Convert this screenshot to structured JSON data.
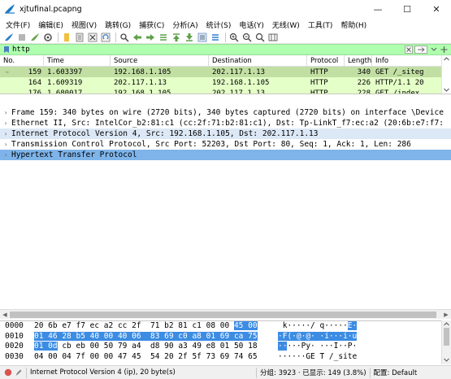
{
  "window": {
    "title": "xjtufinal.pcapng",
    "minimize_glyph": "—",
    "maximize_glyph": "☐",
    "close_glyph": "✕"
  },
  "menu": [
    "文件(F)",
    "编辑(E)",
    "视图(V)",
    "跳转(G)",
    "捕获(C)",
    "分析(A)",
    "统计(S)",
    "电话(Y)",
    "无线(W)",
    "工具(T)",
    "帮助(H)"
  ],
  "filter": {
    "value": "http",
    "accent": "#afffaf"
  },
  "packet_list": {
    "columns": [
      "No.",
      "Time",
      "Source",
      "Destination",
      "Protocol",
      "Length",
      "Info"
    ],
    "rows": [
      {
        "no": "159",
        "time": "1.603397",
        "src": "192.168.1.105",
        "dst": "202.117.1.13",
        "proto": "HTTP",
        "len": "340",
        "info": "GET /_siteg",
        "selected": true,
        "mark": "→"
      },
      {
        "no": "164",
        "time": "1.609319",
        "src": "202.117.1.13",
        "dst": "192.168.1.105",
        "proto": "HTTP",
        "len": "226",
        "info": "HTTP/1.1 20",
        "selected": false,
        "mark": ""
      },
      {
        "no": "176",
        "time": "1.680017",
        "src": "192.168.1.105",
        "dst": "202.117.1.13",
        "proto": "HTTP",
        "len": "228",
        "info": "GET /index",
        "selected": false,
        "mark": ""
      }
    ]
  },
  "details": [
    {
      "text": "Frame 159: 340 bytes on wire (2720 bits), 340 bytes captured (2720 bits) on interface \\Device",
      "state": "normal"
    },
    {
      "text": "Ethernet II, Src: IntelCor_b2:81:c1 (cc:2f:71:b2:81:c1), Dst: Tp-LinkT_f7:ec:a2 (20:6b:e7:f7:",
      "state": "normal"
    },
    {
      "text": "Internet Protocol Version 4, Src: 192.168.1.105, Dst: 202.117.1.13",
      "state": "ipsel"
    },
    {
      "text": "Transmission Control Protocol, Src Port: 52203, Dst Port: 80, Seq: 1, Ack: 1, Len: 286",
      "state": "normal"
    },
    {
      "text": "Hypertext Transfer Protocol",
      "state": "hsel"
    }
  ],
  "bytes": [
    {
      "off": "0000",
      "hex_pre": "20 6b e7 f7 ec a2 cc 2f  71 b2 81 c1 08 00 ",
      "hex_hl": "45 00",
      "hex_post": "",
      "asc_pre": " k·····/ q·····",
      "asc_hl": "E·",
      "asc_post": ""
    },
    {
      "off": "0010",
      "hex_pre": "",
      "hex_hl": "01 46 28 b5 40 00 40 06  83 69 c0 a8 01 69 ca 75",
      "hex_post": "",
      "asc_pre": "",
      "asc_hl": "·F(·@·@· ·i···i·u",
      "asc_post": ""
    },
    {
      "off": "0020",
      "hex_pre": "",
      "hex_hl": "01 0d",
      "hex_post": " cb eb 00 50 79 a4  d8 90 a3 49 e8 01 50 18",
      "asc_pre": "",
      "asc_hl": "··",
      "asc_post": "···Py· ···I··P·"
    },
    {
      "off": "0030",
      "hex_pre": "04 00 04 7f 00 00 47 45  54 20 2f 5f 73 69 74 65",
      "hex_hl": "",
      "hex_post": "",
      "asc_pre": "······GE T /_site",
      "asc_hl": "",
      "asc_post": ""
    }
  ],
  "status": {
    "field": "Internet Protocol Version 4 (ip), 20 byte(s)",
    "packets": "分组: 3923 · 已显示: 149 (3.8%)",
    "profile": "配置: Default"
  }
}
